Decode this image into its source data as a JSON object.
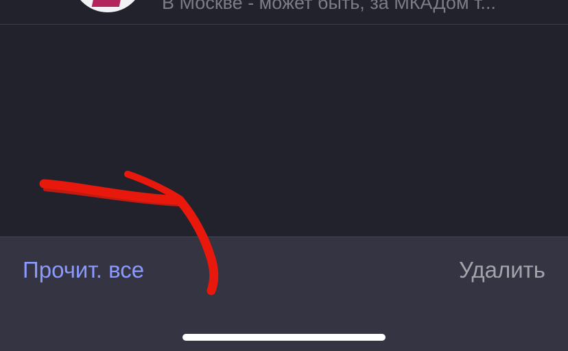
{
  "message": {
    "preview_text": "В Москве - может быть, за МКАДом т..."
  },
  "toolbar": {
    "read_all_label": "Прочит. все",
    "delete_label": "Удалить"
  },
  "colors": {
    "background": "#22222d",
    "toolbar_background": "#343442",
    "accent": "#8b9aff",
    "secondary_text": "#a3a3aa",
    "annotation_red": "#e8190c"
  },
  "icons": {
    "annotation": "red-arrow-icon"
  }
}
